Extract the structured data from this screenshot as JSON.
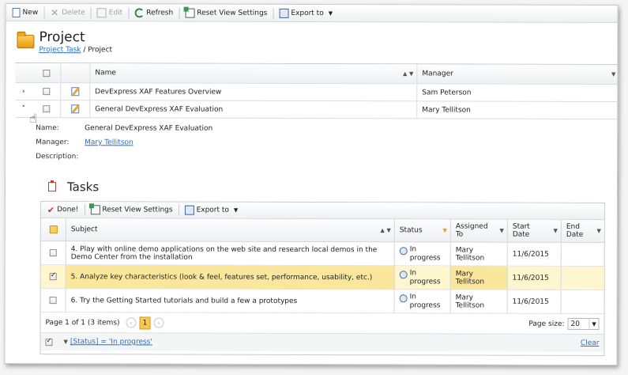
{
  "toolbar": {
    "new": "New",
    "delete": "Delete",
    "edit": "Edit",
    "refresh": "Refresh",
    "reset": "Reset View Settings",
    "export": "Export to"
  },
  "page": {
    "title": "Project",
    "breadcrumb_link": "Project Task",
    "breadcrumb_sep": " / ",
    "breadcrumb_current": "Project"
  },
  "grid": {
    "columns": {
      "name": "Name",
      "manager": "Manager"
    },
    "rows": [
      {
        "name": "DevExpress XAF Features Overview",
        "manager": "Sam Peterson"
      },
      {
        "name": "General DevExpress XAF Evaluation",
        "manager": "Mary Tellitson"
      }
    ]
  },
  "detail": {
    "name_label": "Name:",
    "name_value": "General DevExpress XAF Evaluation",
    "manager_label": "Manager:",
    "manager_value": "Mary Tellitson",
    "description_label": "Description:"
  },
  "tasks": {
    "title": "Tasks",
    "toolbar": {
      "done": "Done!",
      "reset": "Reset View Settings",
      "export": "Export to"
    },
    "columns": {
      "subject": "Subject",
      "status": "Status",
      "assigned": "Assigned To",
      "start": "Start Date",
      "end": "End Date"
    },
    "rows": [
      {
        "subject": "4. Play with online demo applications on the web site and research local demos in the Demo Center from the installation",
        "status": "In progress",
        "assigned": "Mary Tellitson",
        "start": "11/6/2015",
        "end": "",
        "checked": false
      },
      {
        "subject": "5. Analyze key characteristics (look & feel, features set, performance, usability, etc.)",
        "status": "In progress",
        "assigned": "Mary Tellitson",
        "start": "11/6/2015",
        "end": "",
        "checked": true
      },
      {
        "subject": "6. Try the Getting Started tutorials and build a few a prototypes",
        "status": "In progress",
        "assigned": "Mary Tellitson",
        "start": "11/6/2015",
        "end": "",
        "checked": false
      }
    ],
    "pager": {
      "summary": "Page 1 of 1 (3 items)",
      "current_page": "1",
      "page_size_label": "Page size:",
      "page_size": "20"
    },
    "filter": {
      "expression": "[Status] = 'In progress'",
      "clear": "Clear"
    }
  }
}
